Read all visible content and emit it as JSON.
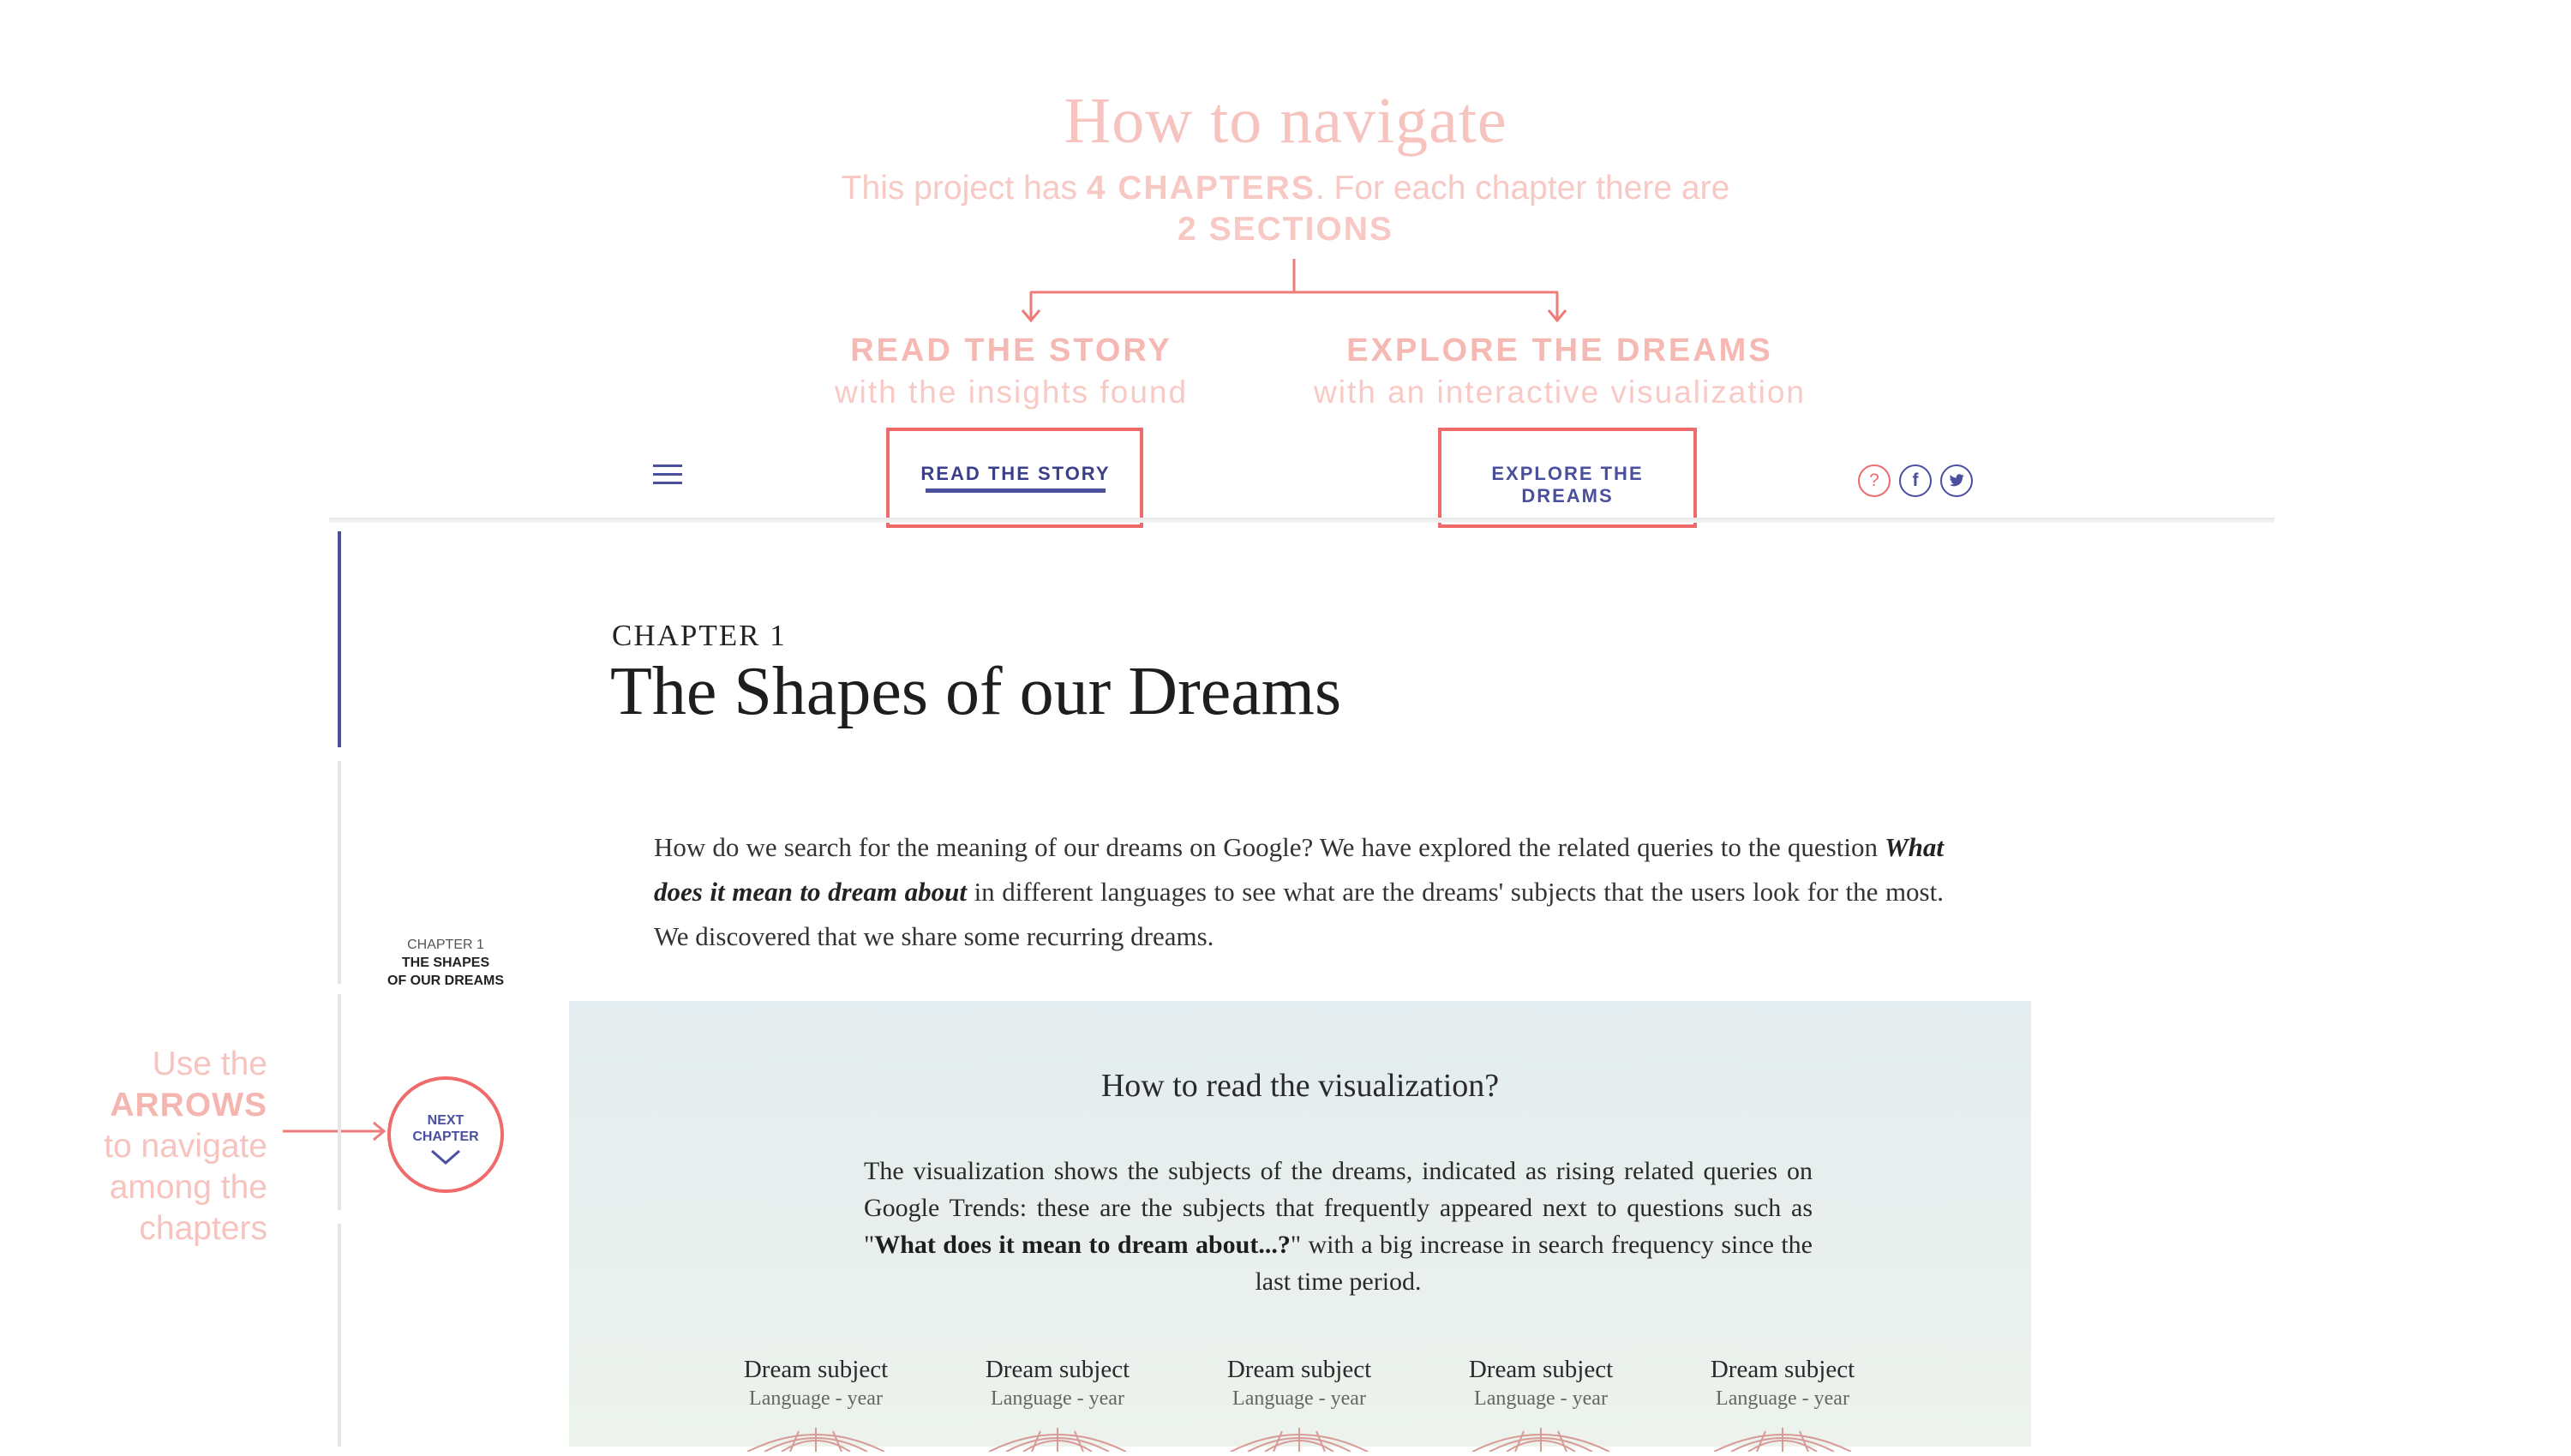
{
  "annotation": {
    "title": "How to navigate",
    "desc_pre": "This project has ",
    "desc_chapters": "4 CHAPTERS",
    "desc_mid": ". For each chapter there are",
    "desc_sections": "2 SECTIONS",
    "left_title": "READ THE STORY",
    "left_sub": "with the insights found",
    "right_title": "EXPLORE THE DREAMS",
    "right_sub": "with an interactive visualization",
    "arrows_line1": "Use the",
    "arrows_bold": "ARROWS",
    "arrows_line3": "to navigate",
    "arrows_line4": "among the",
    "arrows_line5": "chapters"
  },
  "header": {
    "menu_icon": "hamburger-icon",
    "nav": [
      {
        "label": "READ THE STORY",
        "active": true
      },
      {
        "label": "EXPLORE THE DREAMS",
        "active": false
      }
    ],
    "social": {
      "help": "?",
      "facebook": "f",
      "twitter": "twitter-icon"
    }
  },
  "sidebar": {
    "chapter_num": "CHAPTER 1",
    "chapter_name_1": "THE SHAPES",
    "chapter_name_2": "OF OUR DREAMS",
    "next_line1": "NEXT",
    "next_line2": "CHAPTER"
  },
  "main": {
    "kicker": "CHAPTER 1",
    "title": "The Shapes of our Dreams",
    "intro_pre": "How do we search for the meaning of our dreams on Google? We have explored the related queries to the question ",
    "intro_bold": "What does it mean to dream about",
    "intro_post": " in different languages to see what are the dreams' subjects that the users look for the most. We discovered that we share some recurring dreams."
  },
  "viz": {
    "heading": "How to read the visualization?",
    "desc_pre": "The visualization shows the subjects of the dreams, indicated as rising related queries on Google Trends: these are the subjects that frequently appeared next to questions such as \"",
    "desc_bold": "What does it mean to dream about...?",
    "desc_post": "\" with a big increase in search frequency since the last time period.",
    "legend": [
      {
        "subject": "Dream subject",
        "meta": "Language - year"
      },
      {
        "subject": "Dream subject",
        "meta": "Language - year"
      },
      {
        "subject": "Dream subject",
        "meta": "Language - year"
      },
      {
        "subject": "Dream subject",
        "meta": "Language - year"
      },
      {
        "subject": "Dream subject",
        "meta": "Language - year"
      }
    ]
  },
  "colors": {
    "accent": "#4a4f9e",
    "annotation": "#f6c3bf",
    "highlight": "#ef6b6b",
    "panel": "#e3ecee"
  }
}
